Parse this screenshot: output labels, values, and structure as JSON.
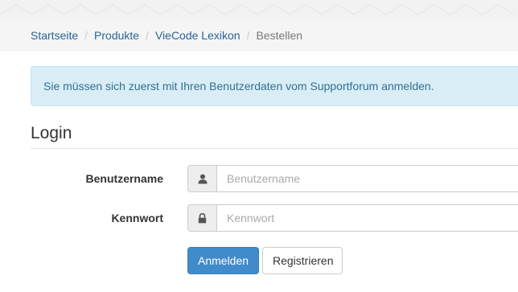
{
  "breadcrumb": {
    "items": [
      {
        "label": "Startseite"
      },
      {
        "label": "Produkte"
      },
      {
        "label": "VieCode Lexikon"
      }
    ],
    "separator": "/",
    "active": "Bestellen"
  },
  "alert": {
    "text": "Sie müssen sich zuerst mit Ihren Benutzerdaten vom Supportforum anmelden."
  },
  "login": {
    "title": "Login",
    "username": {
      "label": "Benutzername",
      "placeholder": "Benutzername",
      "value": "",
      "icon": "user-icon"
    },
    "password": {
      "label": "Kennwort",
      "placeholder": "Kennwort",
      "value": "",
      "icon": "lock-icon"
    },
    "submit_label": "Anmelden",
    "register_label": "Registrieren"
  },
  "colors": {
    "link": "#2a6496",
    "alert_bg": "#d9edf7",
    "alert_text": "#31708f",
    "primary": "#428bca"
  }
}
